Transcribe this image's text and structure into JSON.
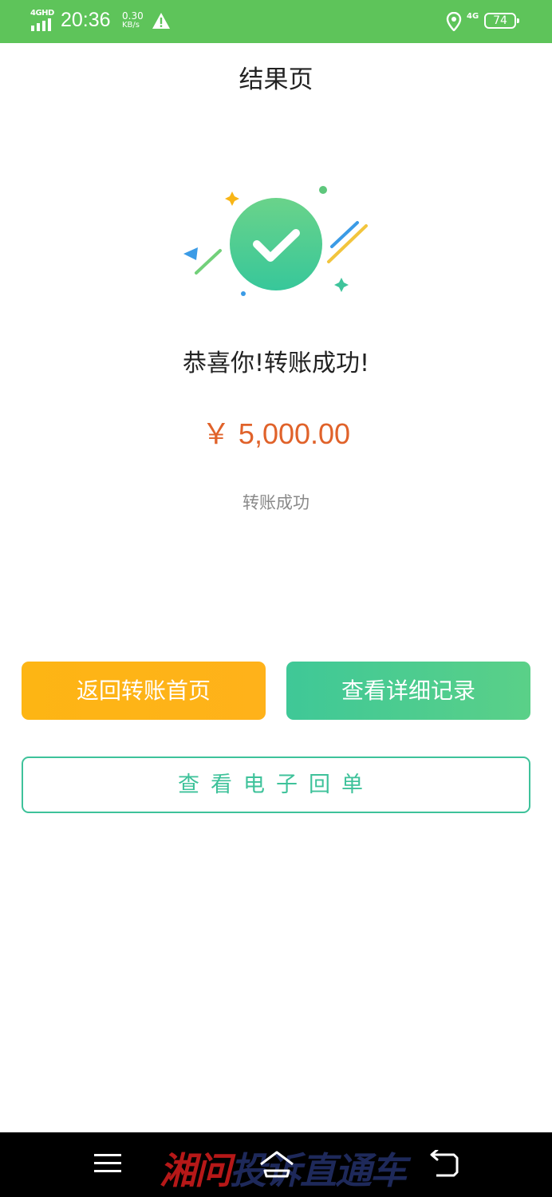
{
  "status_bar": {
    "network": "4GHD",
    "time": "20:36",
    "speed_value": "0.30",
    "speed_unit": "KB/s",
    "network_2": "4G",
    "battery": "74",
    "icons": [
      "signal-icon",
      "warning-icon",
      "location-icon",
      "battery-icon"
    ]
  },
  "header": {
    "title": "结果页"
  },
  "result": {
    "title": "恭喜你!转账成功!",
    "amount": "￥ 5,000.00",
    "status": "转账成功"
  },
  "buttons": {
    "back_home": "返回转账首页",
    "view_details": "查看详细记录",
    "view_receipt": "查看电子回单"
  },
  "nav_bar": {
    "icons": [
      "menu-icon",
      "home-icon",
      "back-icon"
    ],
    "watermark_red": "湘问",
    "watermark_blue": "投诉直通车"
  },
  "colors": {
    "status_bar": "#5ec45a",
    "amount": "#e0622a",
    "back_button": "#fdb514",
    "detail_button": "#3fc897",
    "receipt_border": "#3ec29a"
  }
}
